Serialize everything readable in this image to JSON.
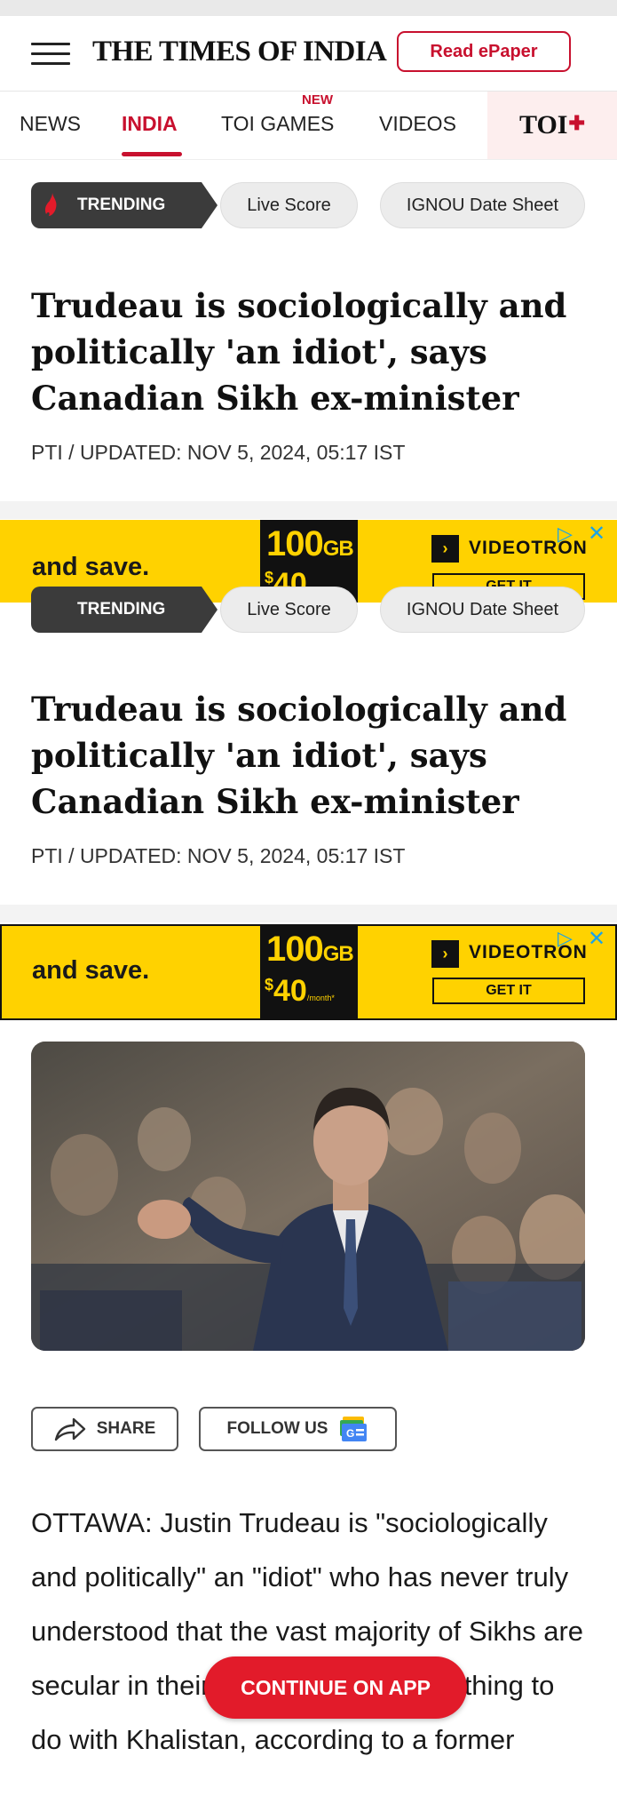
{
  "header": {
    "brand": "THE TIMES OF INDIA",
    "epaper_label": "Read ePaper"
  },
  "nav": {
    "items": [
      {
        "label": "NEWS",
        "active": false
      },
      {
        "label": "INDIA",
        "active": true
      },
      {
        "label": "TOI GAMES",
        "active": false,
        "badge": "NEW"
      },
      {
        "label": "VIDEOS",
        "active": false
      }
    ],
    "toi_plus": "TOI",
    "accent_color": "#c8102e"
  },
  "trending": {
    "label": "TRENDING",
    "chips": [
      "Live Score",
      "IGNOU Date Sheet"
    ]
  },
  "article": {
    "headline": "Trudeau is sociologically and politically 'an idiot', says Canadian Sikh ex-minister",
    "byline": "PTI / UPDATED: NOV 5, 2024, 05:17 IST",
    "paragraph": "OTTAWA: Justin Trudeau is \"sociologically and politically\" an \"idiot\" who has never truly understood that the vast majority of Sikhs are secular in their outlook and want nothing to do with Khalistan, according to a former"
  },
  "ad": {
    "tagline": "and save.",
    "data_amount": "100",
    "data_unit": "GB",
    "price_currency": "$",
    "price": "40",
    "price_period": "/month*",
    "brand": "VIDEOTRON",
    "cta": "GET IT",
    "bg_color": "#ffd200"
  },
  "actions": {
    "share_label": "SHARE",
    "follow_label": "FOLLOW US",
    "continue_label": "CONTINUE ON APP"
  },
  "icons": [
    "menu-icon",
    "flame-icon",
    "share-icon",
    "google-news-icon",
    "adchoices-icon",
    "close-icon"
  ]
}
